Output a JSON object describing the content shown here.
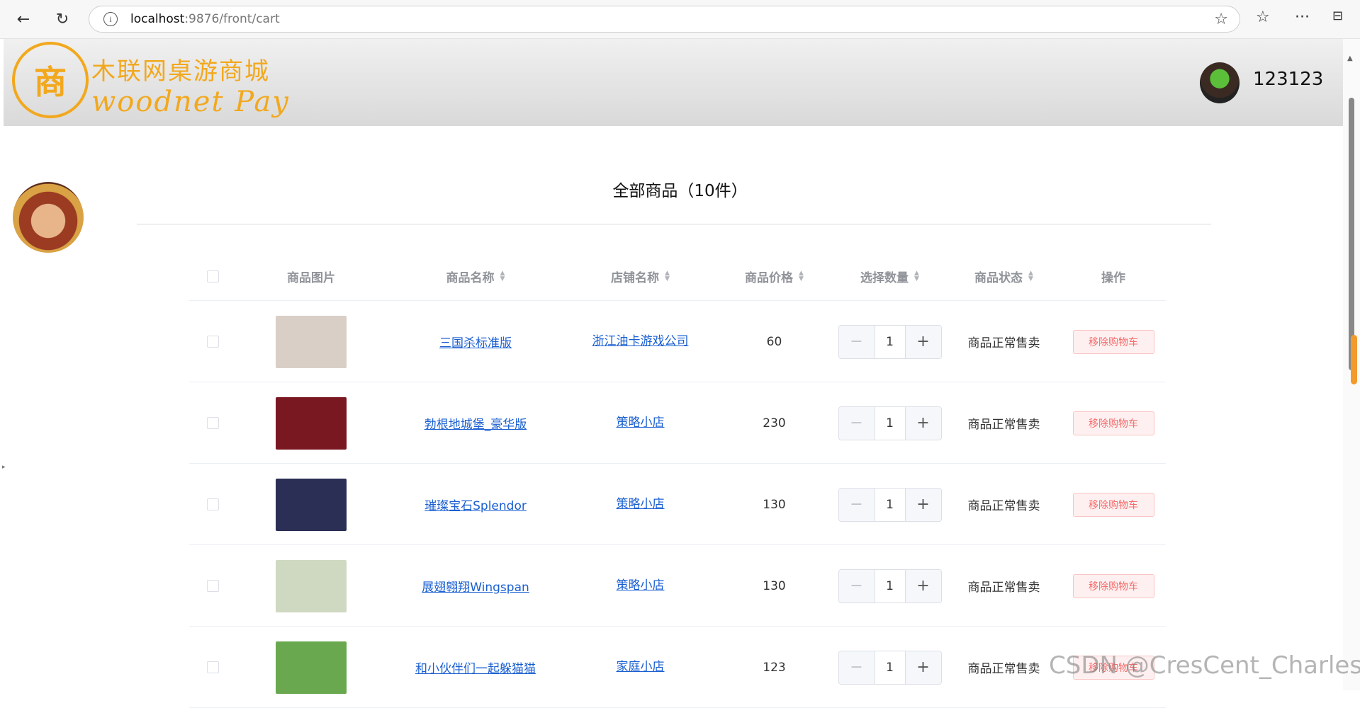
{
  "browser": {
    "url_host": "localhost",
    "url_path": ":9876/front/cart"
  },
  "header": {
    "logo_glyph": "商",
    "title": "木联网桌游商城",
    "subtitle": "woodnet Pay",
    "username": "123123",
    "accent_color": "#f2a81d"
  },
  "cart": {
    "title": "全部商品（10件）",
    "columns": {
      "image": "商品图片",
      "name": "商品名称",
      "shop": "店铺名称",
      "price": "商品价格",
      "quantity": "选择数量",
      "status": "商品状态",
      "action": "操作"
    },
    "items": [
      {
        "name": "三国杀标准版",
        "shop": "浙江油卡游戏公司",
        "price": "60",
        "quantity": "1",
        "status": "商品正常售卖",
        "action": "移除购物车",
        "img_color": "#d9cfc6"
      },
      {
        "name": "勃根地城堡_豪华版",
        "shop": "策略小店",
        "price": "230",
        "quantity": "1",
        "status": "商品正常售卖",
        "action": "移除购物车",
        "img_color": "#7a1822"
      },
      {
        "name": "璀璨宝石Splendor",
        "shop": "策略小店",
        "price": "130",
        "quantity": "1",
        "status": "商品正常售卖",
        "action": "移除购物车",
        "img_color": "#2b2f55"
      },
      {
        "name": "展翅翱翔Wingspan",
        "shop": "策略小店",
        "price": "130",
        "quantity": "1",
        "status": "商品正常售卖",
        "action": "移除购物车",
        "img_color": "#cfd9c2"
      },
      {
        "name": "和小伙伴们一起躲猫猫",
        "shop": "家庭小店",
        "price": "123",
        "quantity": "1",
        "status": "商品正常售卖",
        "action": "移除购物车",
        "img_color": "#6aa84f"
      }
    ]
  },
  "watermark": "CSDN @CresCent_Charles"
}
